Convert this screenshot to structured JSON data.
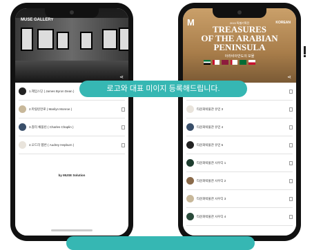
{
  "left_phone": {
    "brand": "MUSE GALLERY",
    "items": [
      {
        "label": "1.제임스딘 ( James Byron Dean )"
      },
      {
        "label": "2.마릴린먼로 ( Marilyn Monroe )"
      },
      {
        "label": "3.찰리 채플린 ( Charles Chaplin )"
      },
      {
        "label": "4.오드리 헵번 ( Audrey Hepburn )"
      }
    ],
    "byline": "by MUSE Solution"
  },
  "right_phone": {
    "logo": "M",
    "language": "KOREAN",
    "exhibition_subtitle": "2015 특별기획전",
    "exhibition_title_line1": "TREASURES",
    "exhibition_title_line2": "OF THE ARABIAN",
    "exhibition_title_line3": "PENINSULA",
    "exhibition_title_ko": "아라비아반도의 보물",
    "items": [
      {
        "label": "타운화박물관 유민 2"
      },
      {
        "label": "타운화박물관 유민 3"
      },
      {
        "label": "타운화박물관 유민 4"
      },
      {
        "label": "타운화박물관 유민 5"
      },
      {
        "label": "타운화박물관 사우디 1"
      },
      {
        "label": "타운화박물관 사우디 2"
      },
      {
        "label": "타운화박물관 사우디 3"
      },
      {
        "label": "타운화박물관 사우디 4"
      }
    ]
  },
  "banner": {
    "text": "로고와 대표 미이지 등록해드립니다."
  },
  "colors": {
    "accent": "#36b7b3",
    "phone_body": "#111111"
  }
}
